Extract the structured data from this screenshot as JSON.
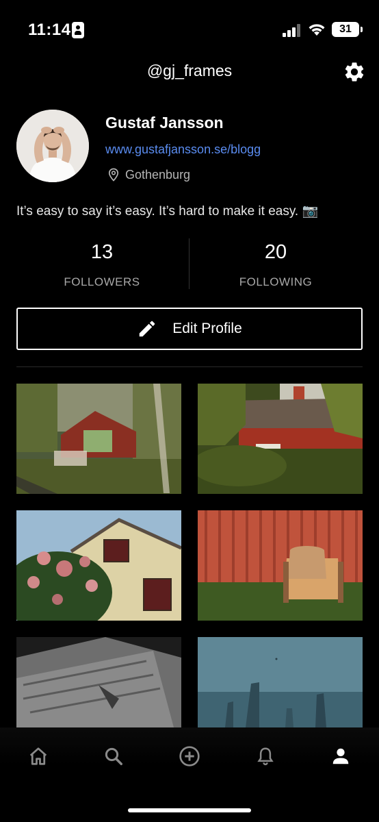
{
  "status_bar": {
    "time": "11:14",
    "battery": "31"
  },
  "header": {
    "username": "@gj_frames"
  },
  "profile": {
    "name": "Gustaf Jansson",
    "website": "www.gustafjansson.se/blogg",
    "location": "Gothenburg",
    "bio": "It’s easy to say it’s easy. It’s hard to make it easy. 📷"
  },
  "stats": {
    "followers_count": "13",
    "followers_label": "FOLLOWERS",
    "following_count": "20",
    "following_label": "FOLLOWING"
  },
  "edit_profile": {
    "label": "Edit Profile"
  },
  "photos": [
    {
      "subject": "red-wooden-house-with-trees"
    },
    {
      "subject": "red-cottage-behind-bushes"
    },
    {
      "subject": "yellow-house-with-hydrangeas"
    },
    {
      "subject": "chair-by-red-wall"
    },
    {
      "subject": "black-and-white-roof-detail"
    },
    {
      "subject": "posts-in-foggy-water"
    }
  ],
  "bottom_nav": [
    "home-icon",
    "search-icon",
    "add-icon",
    "bell-icon",
    "profile-icon"
  ]
}
